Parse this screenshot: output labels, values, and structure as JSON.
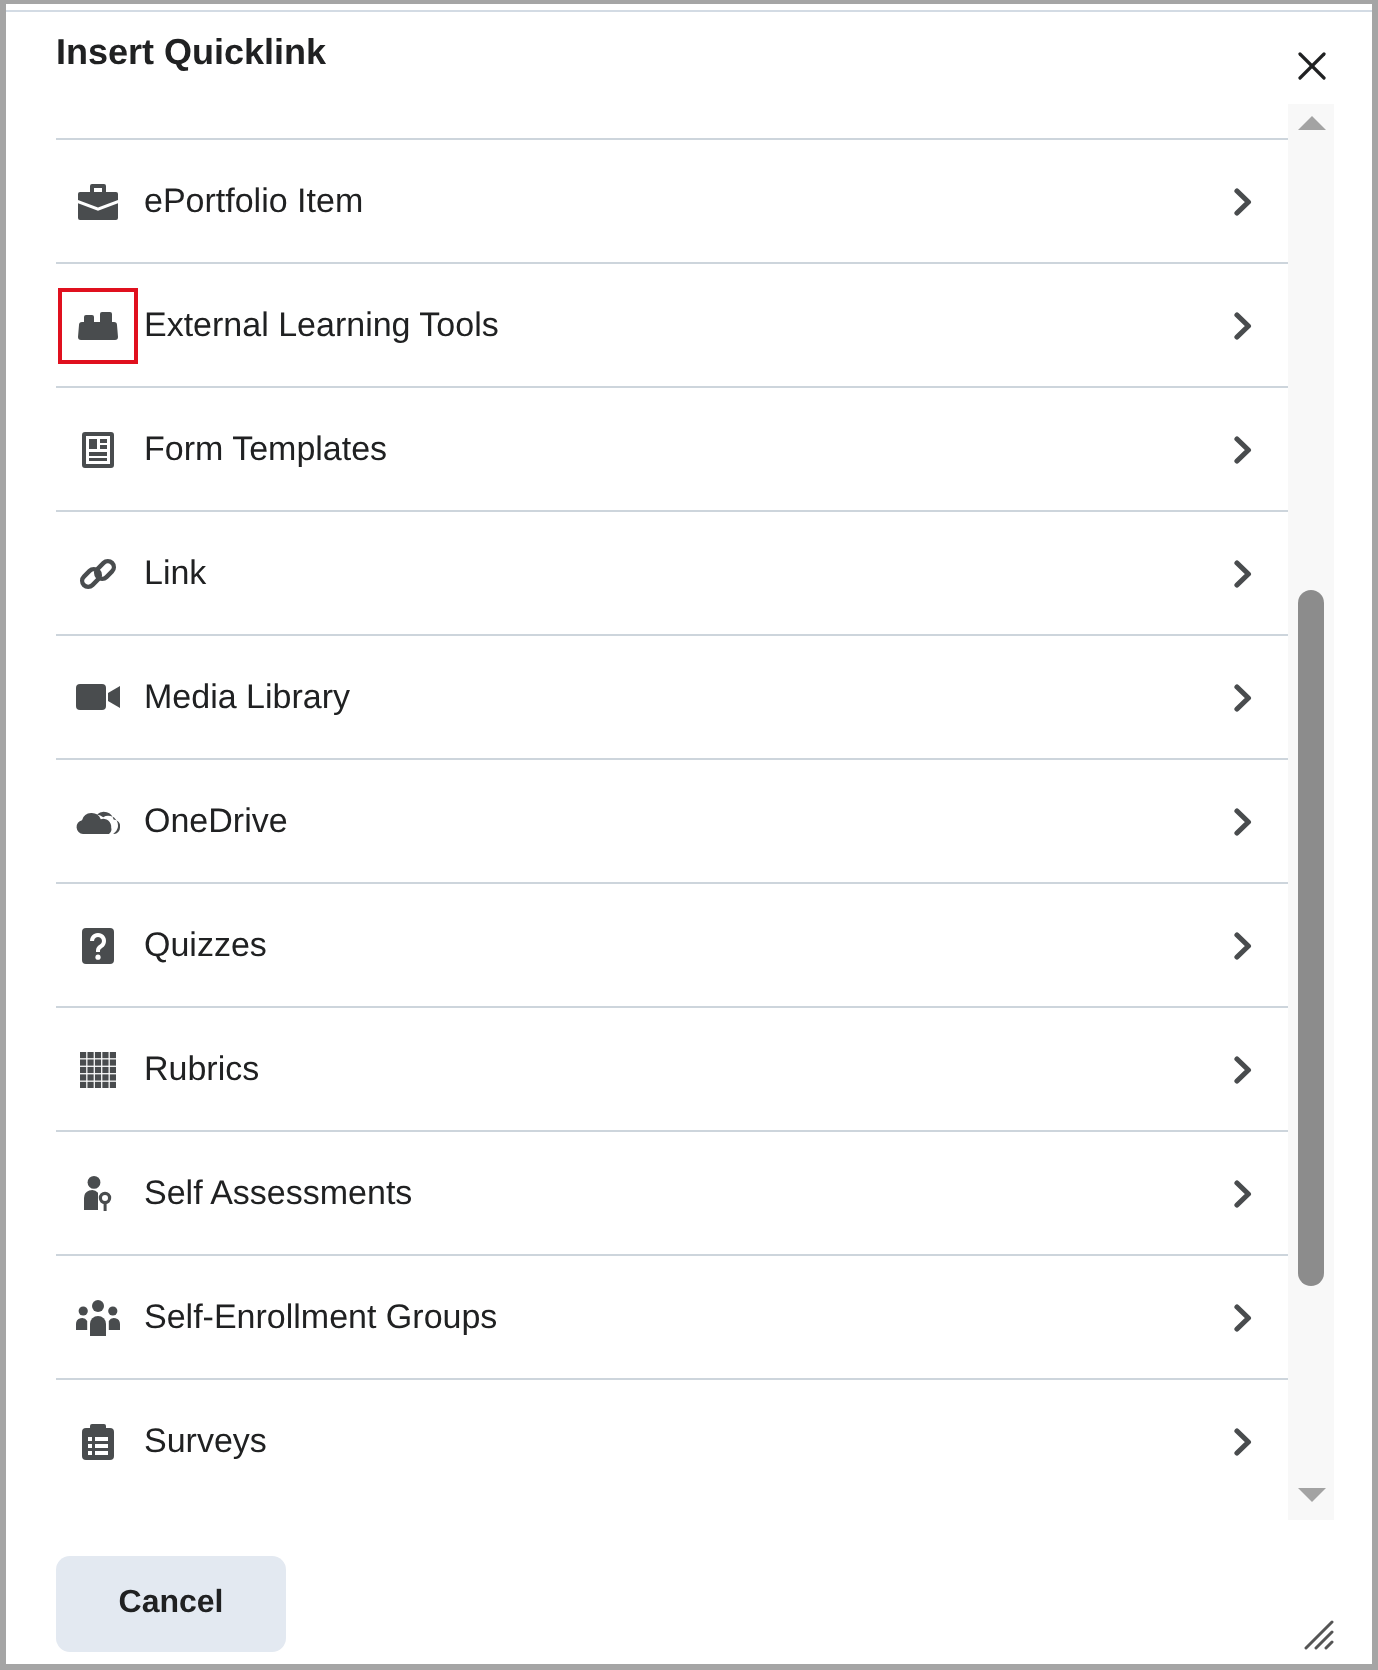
{
  "dialog": {
    "title": "Insert Quicklink"
  },
  "items": [
    {
      "label": "ePortfolio Item",
      "highlighted": false
    },
    {
      "label": "External Learning Tools",
      "highlighted": true
    },
    {
      "label": "Form Templates",
      "highlighted": false
    },
    {
      "label": "Link",
      "highlighted": false
    },
    {
      "label": "Media Library",
      "highlighted": false
    },
    {
      "label": "OneDrive",
      "highlighted": false
    },
    {
      "label": "Quizzes",
      "highlighted": false
    },
    {
      "label": "Rubrics",
      "highlighted": false
    },
    {
      "label": "Self Assessments",
      "highlighted": false
    },
    {
      "label": "Self-Enrollment Groups",
      "highlighted": false
    },
    {
      "label": "Surveys",
      "highlighted": false
    }
  ],
  "footer": {
    "buttons": [
      {
        "label": "Cancel"
      }
    ]
  }
}
